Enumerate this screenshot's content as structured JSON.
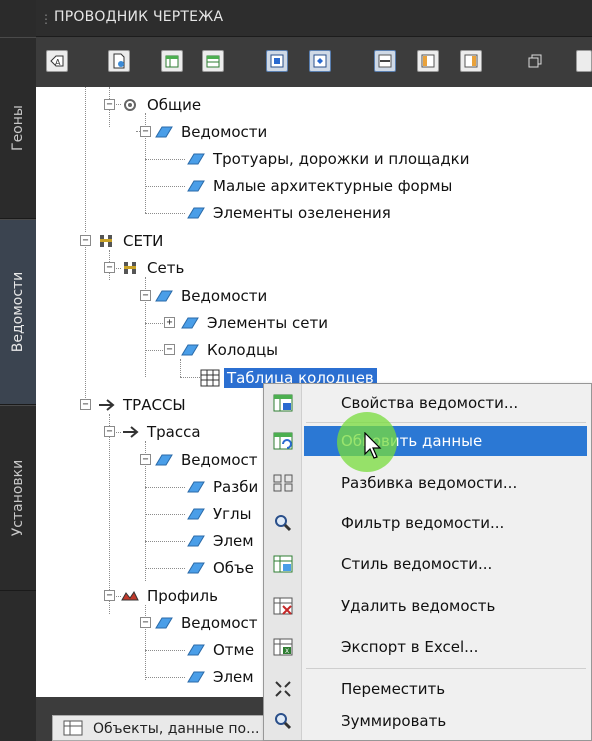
{
  "window": {
    "title": "ПРОВОДНИК ЧЕРТЕЖА"
  },
  "side_tabs": [
    {
      "label": "Геоны",
      "active": false
    },
    {
      "label": "Ведомости",
      "active": true
    },
    {
      "label": "Установки",
      "active": false
    }
  ],
  "tree": {
    "nodes": [
      {
        "label": "Общие",
        "icon": "gear-group-icon"
      },
      {
        "label": "Ведомости",
        "icon": "folder-icon"
      },
      {
        "label": "Тротуары, дорожки и площадки",
        "icon": "folder-icon"
      },
      {
        "label": "Малые архитектурные формы",
        "icon": "folder-icon"
      },
      {
        "label": "Элементы озеленения",
        "icon": "folder-icon"
      },
      {
        "label": "СЕТИ",
        "icon": "network-icon"
      },
      {
        "label": "Сеть",
        "icon": "network-icon"
      },
      {
        "label": "Ведомости",
        "icon": "folder-icon"
      },
      {
        "label": "Элементы сети",
        "icon": "folder-icon"
      },
      {
        "label": "Колодцы",
        "icon": "folder-icon"
      },
      {
        "label": "Таблица колодцев",
        "icon": "table-icon",
        "selected": true
      },
      {
        "label": "ТРАССЫ",
        "icon": "route-icon"
      },
      {
        "label": "Трасса",
        "icon": "route-icon"
      },
      {
        "label": "Ведомост",
        "icon": "folder-icon"
      },
      {
        "label": "Разби",
        "icon": "folder-icon"
      },
      {
        "label": "Углы",
        "icon": "folder-icon"
      },
      {
        "label": "Элем",
        "icon": "folder-icon"
      },
      {
        "label": "Объе",
        "icon": "folder-icon"
      },
      {
        "label": "Профиль",
        "icon": "profile-icon"
      },
      {
        "label": "Ведомост",
        "icon": "folder-icon"
      },
      {
        "label": "Отме",
        "icon": "folder-icon"
      },
      {
        "label": "Элем",
        "icon": "folder-icon"
      }
    ]
  },
  "context_menu": {
    "items": [
      {
        "label": "Свойства ведомости...",
        "icon": "table-properties-icon"
      },
      {
        "label": "Обновить данные",
        "icon": "table-refresh-icon",
        "hover": true
      },
      {
        "label": "Разбивка ведомости...",
        "icon": "table-split-icon"
      },
      {
        "label": "Фильтр ведомости...",
        "icon": "magnifier-icon"
      },
      {
        "label": "Стиль ведомости...",
        "icon": "table-style-icon"
      },
      {
        "label": "Удалить ведомость",
        "icon": "table-delete-icon"
      },
      {
        "label": "Экспорт в Excel...",
        "icon": "table-excel-icon"
      },
      {
        "label": "Переместить",
        "icon": "move-arrows-icon"
      },
      {
        "label": "Зуммировать",
        "icon": "zoom-icon"
      }
    ]
  },
  "status": {
    "text": "Объекты, данные по..."
  },
  "colors": {
    "selection": "#2b6fd1",
    "menu_hover": "#2b78d4",
    "folder": "#4a9ee8"
  }
}
